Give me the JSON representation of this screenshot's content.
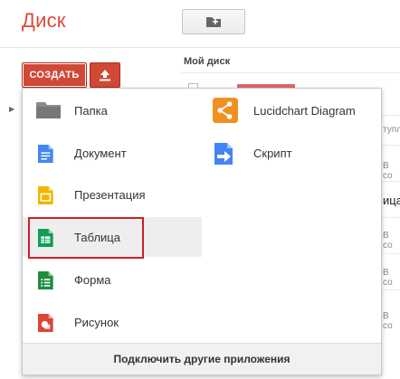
{
  "app": {
    "title": "Диск"
  },
  "toolbar": {
    "create_label": "СОЗДАТЬ"
  },
  "breadcrumb": {
    "label": "Мой диск"
  },
  "background": {
    "fragments": [
      "тупл",
      "В со",
      "В со",
      "ицар",
      "В со",
      "В со"
    ]
  },
  "menu": {
    "items_col1": [
      {
        "label": "Папка",
        "icon": "folder-icon"
      },
      {
        "label": "Документ",
        "icon": "document-icon"
      },
      {
        "label": "Презентация",
        "icon": "presentation-icon"
      },
      {
        "label": "Таблица",
        "icon": "spreadsheet-icon",
        "selected": true
      },
      {
        "label": "Форма",
        "icon": "form-icon"
      },
      {
        "label": "Рисунок",
        "icon": "drawing-icon"
      }
    ],
    "items_col2": [
      {
        "label": "Lucidchart Diagram",
        "icon": "lucidchart-icon"
      },
      {
        "label": "Скрипт",
        "icon": "script-icon"
      }
    ],
    "footer_label": "Подключить другие приложения"
  },
  "colors": {
    "brand_red": "#dd4b39",
    "button_red": "#d14836",
    "highlight_border": "#cc1f26",
    "docs_blue": "#4285f4",
    "slides_yellow": "#f4b400",
    "sheets_green": "#0f9d58",
    "forms_green": "#1e8e3e",
    "drawing_red": "#db4437",
    "lucid_orange": "#f09021"
  }
}
